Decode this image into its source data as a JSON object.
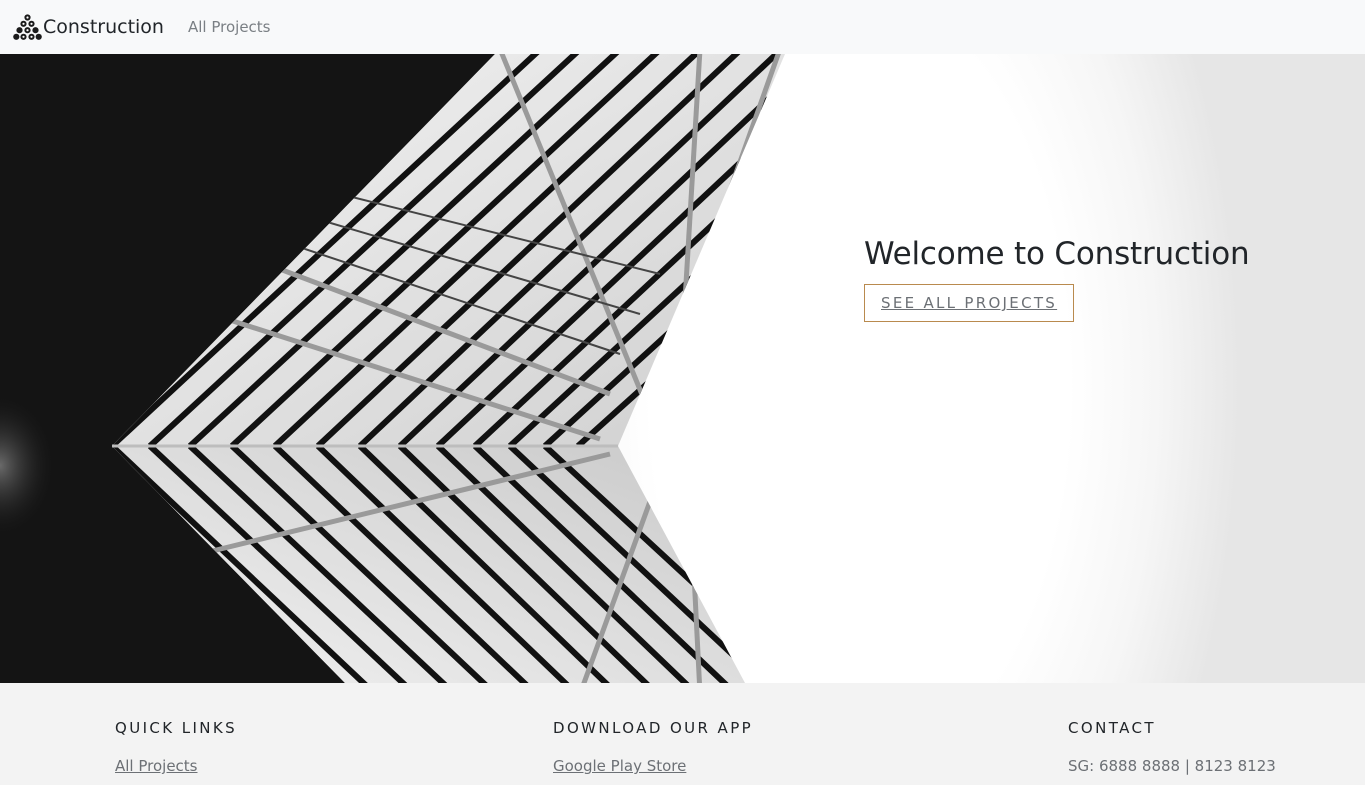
{
  "navbar": {
    "brand_name": "Construction",
    "links": [
      {
        "label": "All Projects"
      }
    ]
  },
  "hero": {
    "title": "Welcome to Construction",
    "button_label": "SEE ALL PROJECTS"
  },
  "footer": {
    "quick_links": {
      "heading": "QUICK LINKS",
      "links": [
        {
          "label": "All Projects"
        }
      ]
    },
    "download": {
      "heading": "DOWNLOAD OUR APP",
      "links": [
        {
          "label": "Google Play Store"
        }
      ]
    },
    "contact": {
      "heading": "CONTACT",
      "phone_text": "SG: 6888 8888 | 8123 8123"
    }
  },
  "icons": {
    "brand": "construction-logo-icon"
  },
  "colors": {
    "navbar_bg": "#f8f9fa",
    "footer_bg": "#f3f3f3",
    "button_border": "#b98a4e",
    "dark_panel": "#141414"
  }
}
